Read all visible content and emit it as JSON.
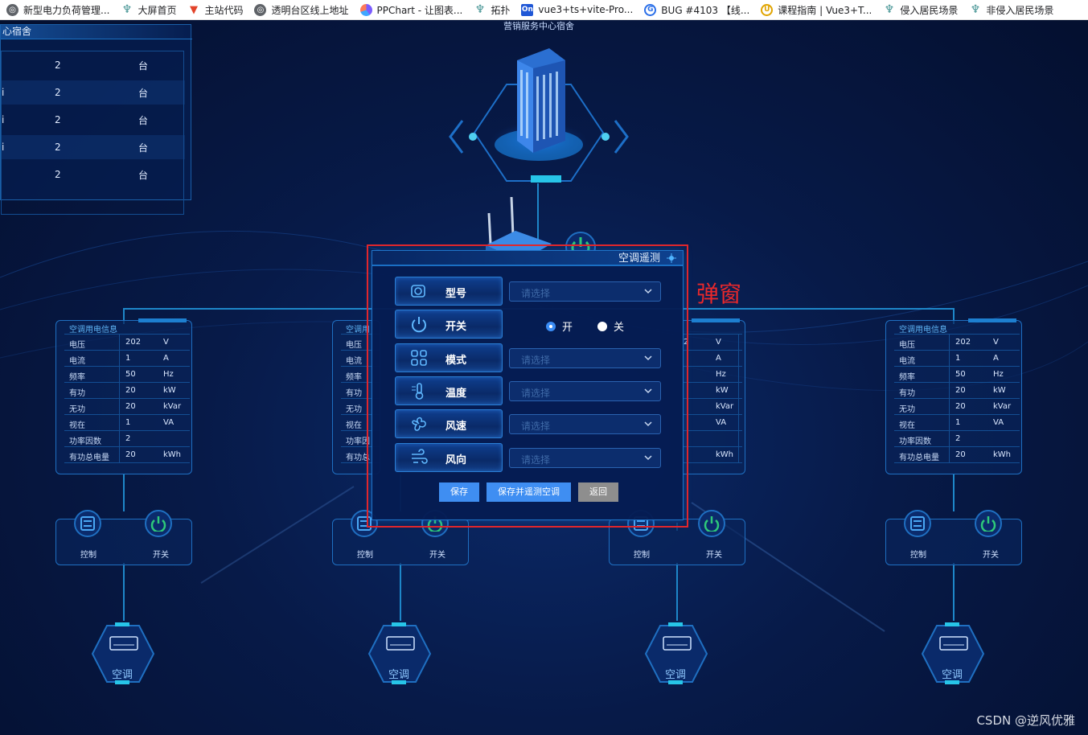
{
  "bookmarks": [
    {
      "icon": "globe-icon",
      "label": "新型电力负荷管理..."
    },
    {
      "icon": "plant-icon",
      "label": "大屏首页"
    },
    {
      "icon": "gitlab-icon",
      "label": "主站代码"
    },
    {
      "icon": "globe-icon",
      "label": "透明台区线上地址"
    },
    {
      "icon": "ppchart-icon",
      "label": "PPChart - 让图表..."
    },
    {
      "icon": "plant-icon",
      "label": "拓扑"
    },
    {
      "icon": "on-icon",
      "label": "vue3+ts+vite-Pro..."
    },
    {
      "icon": "g-icon",
      "label": "BUG #4103 【线..."
    },
    {
      "icon": "u-icon",
      "label": "课程指南 | Vue3+T..."
    },
    {
      "icon": "plant-icon",
      "label": "侵入居民场景"
    },
    {
      "icon": "plant-icon",
      "label": "非侵入居民场景"
    }
  ],
  "building_label": "营销服务中心宿舍",
  "top_panel": {
    "title": "心宿舍",
    "rows": [
      {
        "prefix": "",
        "value": "2",
        "unit": "台"
      },
      {
        "prefix": "i",
        "value": "2",
        "unit": "台"
      },
      {
        "prefix": "i",
        "value": "2",
        "unit": "台"
      },
      {
        "prefix": "i",
        "value": "2",
        "unit": "台"
      },
      {
        "prefix": "",
        "value": "2",
        "unit": "台"
      }
    ]
  },
  "node_panel": {
    "title": "空调用电信息",
    "rows": [
      {
        "key": "电压",
        "value": "202",
        "unit": "V"
      },
      {
        "key": "电流",
        "value": "1",
        "unit": "A"
      },
      {
        "key": "频率",
        "value": "50",
        "unit": "Hz"
      },
      {
        "key": "有功",
        "value": "20",
        "unit": "kW"
      },
      {
        "key": "无功",
        "value": "20",
        "unit": "kVar"
      },
      {
        "key": "视在",
        "value": "1",
        "unit": "VA"
      },
      {
        "key": "功率因数",
        "value": "2",
        "unit": ""
      },
      {
        "key": "有功总电量",
        "value": "20",
        "unit": "kWh"
      }
    ],
    "partial_title": "空调用",
    "partial_keys": [
      "电压",
      "电流",
      "频率",
      "有功",
      "无功",
      "视在",
      "功率因",
      "有功总"
    ],
    "partial_values": [
      "2",
      "",
      "",
      "",
      "",
      "",
      "",
      ""
    ],
    "partial_units": [
      "V",
      "A",
      "Hz",
      "kW",
      "kVar",
      "VA",
      "",
      "kWh"
    ],
    "control_label": "控制",
    "switch_label": "开关",
    "ac_label": "空调"
  },
  "dialog": {
    "title": "空调遥测",
    "rows": [
      {
        "label": "型号",
        "icon": "model-icon",
        "placeholder": "请选择"
      },
      {
        "label": "开关",
        "icon": "power-icon"
      },
      {
        "label": "模式",
        "icon": "mode-icon",
        "placeholder": "请选择"
      },
      {
        "label": "温度",
        "icon": "thermometer-icon",
        "placeholder": "请选择"
      },
      {
        "label": "风速",
        "icon": "wind-speed-icon",
        "placeholder": "请选择"
      },
      {
        "label": "风向",
        "icon": "wind-direction-icon",
        "placeholder": "请选择"
      }
    ],
    "radio_on": "开",
    "radio_off": "关",
    "radio_selected": "开",
    "save": "保存",
    "save_telemetry": "保存并遥测空调",
    "back": "返回"
  },
  "annotation": "弹窗",
  "watermark": "CSDN @逆风优雅",
  "colors": {
    "accent": "#3f8ef2",
    "annotation": "#e0262c",
    "line": "#1e87c9"
  }
}
